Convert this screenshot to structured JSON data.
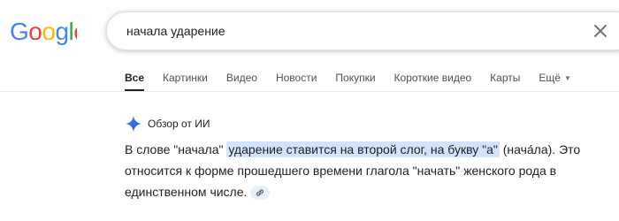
{
  "logo": {
    "text": "Google"
  },
  "search": {
    "query": "начала ударение",
    "clear_icon": "close-icon"
  },
  "tabs": [
    {
      "label": "Все",
      "active": true
    },
    {
      "label": "Картинки"
    },
    {
      "label": "Видео"
    },
    {
      "label": "Новости"
    },
    {
      "label": "Покупки"
    },
    {
      "label": "Короткие видео"
    },
    {
      "label": "Карты"
    },
    {
      "label": "Ещё"
    }
  ],
  "ai_overview": {
    "icon": "sparkle-icon",
    "title": "Обзор от ИИ",
    "answer_prefix": "В слове \"начала\" ",
    "answer_highlight": "ударение ставится на второй слог, на букву \"а\"",
    "answer_rest": " (нача́ла). Это относится к форме прошедшего времени глагола \"начать\" женского рода в единственном числе.",
    "link_icon": "link-icon"
  },
  "colors": {
    "highlight": "#d3e3fd",
    "tab_active": "#202124",
    "text_secondary": "#4d5156"
  }
}
